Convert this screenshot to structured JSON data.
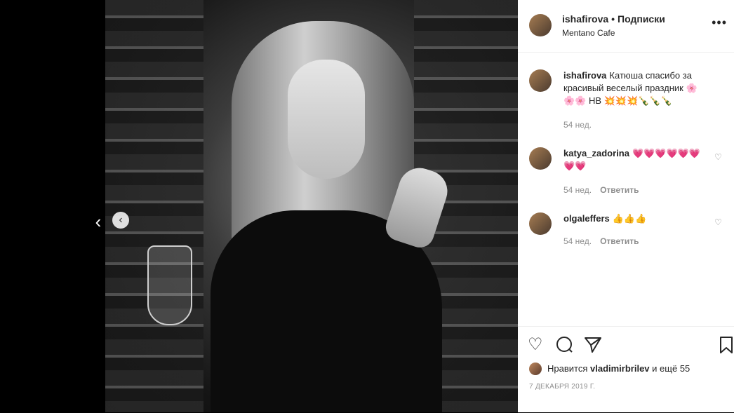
{
  "post": {
    "username": "ishafirova",
    "separator": "•",
    "follow_label": "Подписки",
    "location": "Mentano Cafe",
    "more_icon": "more-horizontal-icon"
  },
  "media": {
    "prev_label": "‹",
    "prev_btn_label": "‹"
  },
  "comments": [
    {
      "username": "ishafirova",
      "text": "Катюша спасибо за красивый веселый праздник 🌸🌸🌸 НВ 💥💥💥🍾🍾🍾",
      "time": "54 нед.",
      "reply": ""
    },
    {
      "username": "katya_zadorina",
      "text": "💗💗💗💗💗💗💗💗",
      "time": "54 нед.",
      "reply": "Ответить"
    },
    {
      "username": "olgaleffers",
      "text": "👍👍👍",
      "time": "54 нед.",
      "reply": "Ответить"
    }
  ],
  "actions": {
    "like_icon": "heart-icon",
    "comment_icon": "comment-icon",
    "share_icon": "share-icon",
    "save_icon": "bookmark-icon"
  },
  "likes": {
    "prefix": "Нравится",
    "user": "vladimirbrilev",
    "suffix": "и ещё 55"
  },
  "date": "7 ДЕКАБРЯ 2019 Г."
}
